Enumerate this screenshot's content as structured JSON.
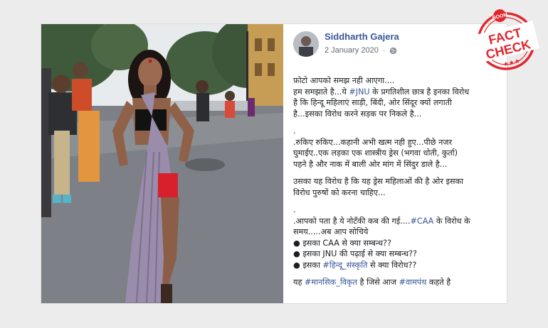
{
  "post": {
    "author": "Siddharth Gajera",
    "date": "2 January 2020",
    "separator": "·",
    "privacy_icon": "globe-icon",
    "lines": [
      {
        "parts": [
          {
            "t": "फ़ोटो आपको समझ नही आएगा....",
            "tag": false
          }
        ]
      },
      {
        "parts": [
          {
            "t": "हम समझाते है...ये ",
            "tag": false
          },
          {
            "t": "#JNU",
            "tag": true
          },
          {
            "t": " के प्रगतिशील छात्र है इनका विरोध",
            "tag": false
          }
        ]
      },
      {
        "parts": [
          {
            "t": "है कि हिन्दू महिलाएं साड़ी, बिंदी, ओर सिंदूर क्यों लगाती",
            "tag": false
          }
        ]
      },
      {
        "parts": [
          {
            "t": "है...इसका विरोध करने सड़क पर निकले है...",
            "tag": false
          }
        ]
      },
      {
        "gap": true
      },
      {
        "parts": [
          {
            "t": ".",
            "tag": false
          }
        ]
      },
      {
        "parts": [
          {
            "t": ".रुकिए रुकिए...कहानी अभी खत्म नही हुए...पीछे नजर",
            "tag": false
          }
        ]
      },
      {
        "parts": [
          {
            "t": "घुमाईए..एक लड़का एक शास्त्रीय ड्रेस (भगवा धोती, कुर्ता)",
            "tag": false
          }
        ]
      },
      {
        "parts": [
          {
            "t": "पहने है और नाक में बाली ओर मांग में सिंदुर डाले है...",
            "tag": false
          }
        ]
      },
      {
        "gap": true
      },
      {
        "parts": [
          {
            "t": "उसका यह विरोध है कि यह ड्रेस महिलाओं की है ओर इसका",
            "tag": false
          }
        ]
      },
      {
        "parts": [
          {
            "t": "विरोध पुरुषों को करना चाहिए...",
            "tag": false
          }
        ]
      },
      {
        "gap": true
      },
      {
        "parts": [
          {
            "t": ".",
            "tag": false
          }
        ]
      },
      {
        "parts": [
          {
            "t": ".आपको पता है ये नोटँकी कब की गई....",
            "tag": false
          },
          {
            "t": "#CAA",
            "tag": true
          },
          {
            "t": " के विरोध के",
            "tag": false
          }
        ]
      },
      {
        "parts": [
          {
            "t": "समय.....अब आप सोचिये",
            "tag": false
          }
        ]
      },
      {
        "parts": [
          {
            "t": "● इसका CAA से क्या सम्बन्ध??",
            "tag": false
          }
        ]
      },
      {
        "parts": [
          {
            "t": "● इसका JNU की पढ़ाई से क्या सम्बन्ध??",
            "tag": false
          }
        ]
      },
      {
        "parts": [
          {
            "t": "● इसका ",
            "tag": false
          },
          {
            "t": "#हिन्दू_संस्कृति",
            "tag": true
          },
          {
            "t": " से क्या विरोध??",
            "tag": false
          }
        ]
      },
      {
        "gap": true
      },
      {
        "parts": [
          {
            "t": "यह ",
            "tag": false
          },
          {
            "t": "#मानसिक_विकृत",
            "tag": true
          },
          {
            "t": " है जिसे आज ",
            "tag": false
          },
          {
            "t": "#वामपंथ",
            "tag": true
          },
          {
            "t": " कहते है",
            "tag": false
          }
        ]
      }
    ]
  },
  "stamp": {
    "brand": "BOOM",
    "line1": "FACT",
    "line2": "CHECK",
    "stars": "★★★",
    "color": "#e2262d"
  },
  "colors": {
    "link": "#385898",
    "text": "#1c1e21",
    "saree": "#9a8dac",
    "skirt": "#d7202b"
  }
}
